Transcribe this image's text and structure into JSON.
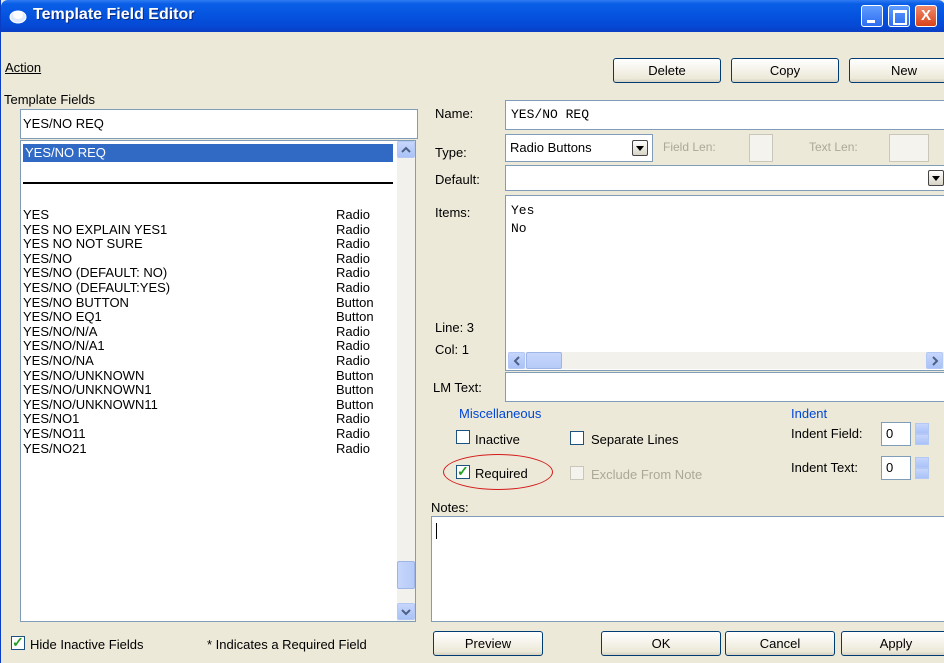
{
  "window": {
    "title": "Template Field Editor"
  },
  "menu": {
    "action": "Action"
  },
  "toolbar": {
    "delete": "Delete",
    "copy": "Copy",
    "new": "New"
  },
  "left": {
    "template_fields_label": "Template Fields",
    "search_value": "YES/NO REQ",
    "selected": "YES/NO REQ",
    "fields": [
      {
        "name": "YES",
        "type": "Radio"
      },
      {
        "name": "YES NO EXPLAIN YES1",
        "type": "Radio"
      },
      {
        "name": "YES NO NOT SURE",
        "type": "Radio"
      },
      {
        "name": "YES/NO",
        "type": "Radio"
      },
      {
        "name": "YES/NO (DEFAULT: NO)",
        "type": "Radio"
      },
      {
        "name": "YES/NO (DEFAULT:YES)",
        "type": "Radio"
      },
      {
        "name": "YES/NO BUTTON",
        "type": "Button"
      },
      {
        "name": "YES/NO EQ1",
        "type": "Button"
      },
      {
        "name": "YES/NO/N/A",
        "type": "Radio"
      },
      {
        "name": "YES/NO/N/A1",
        "type": "Radio"
      },
      {
        "name": "YES/NO/NA",
        "type": "Radio"
      },
      {
        "name": "YES/NO/UNKNOWN",
        "type": "Button"
      },
      {
        "name": "YES/NO/UNKNOWN1",
        "type": "Button"
      },
      {
        "name": "YES/NO/UNKNOWN11",
        "type": "Button"
      },
      {
        "name": "YES/NO1",
        "type": "Radio"
      },
      {
        "name": "YES/NO11",
        "type": "Radio"
      },
      {
        "name": "YES/NO21",
        "type": "Radio"
      }
    ]
  },
  "right": {
    "name_label": "Name:",
    "name_value": "YES/NO REQ",
    "type_label": "Type:",
    "type_value": "Radio Buttons",
    "field_len_label": "Field Len:",
    "text_len_label": "Text Len:",
    "default_label": "Default:",
    "default_value": "",
    "items_label": "Items:",
    "items": [
      "Yes",
      "No"
    ],
    "line_label": "Line: 3",
    "col_label": "Col: 1",
    "lm_text_label": "LM Text:",
    "misc_title": "Miscellaneous",
    "inactive_label": "Inactive",
    "separate_lines_label": "Separate Lines",
    "required_label": "Required",
    "exclude_label": "Exclude From Note",
    "indent_title": "Indent",
    "indent_field_label": "Indent Field:",
    "indent_field_value": "0",
    "indent_text_label": "Indent Text:",
    "indent_text_value": "0",
    "notes_label": "Notes:"
  },
  "bottom": {
    "hide_inactive_label": "Hide Inactive Fields",
    "required_note": "* Indicates a Required Field",
    "preview": "Preview",
    "ok": "OK",
    "cancel": "Cancel",
    "apply": "Apply"
  },
  "state": {
    "inactive": false,
    "separate_lines": false,
    "required": true,
    "exclude_from_note": false,
    "hide_inactive": true
  },
  "colors": {
    "titlebar": "#0553df",
    "selection": "#316ac5",
    "highlight_oval": "#d41a1a",
    "group_title": "#0046d5"
  }
}
